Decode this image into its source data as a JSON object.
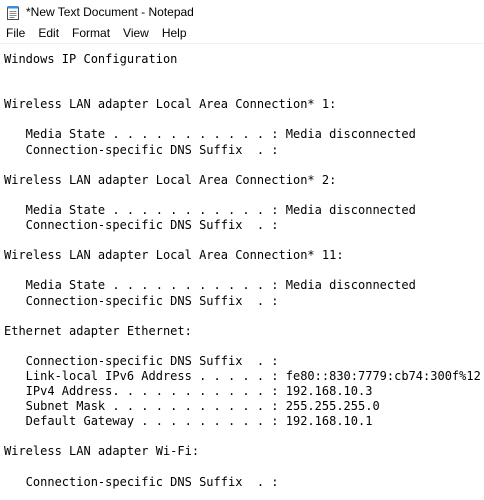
{
  "window": {
    "title": "*New Text Document - Notepad",
    "app_icon": "notepad-icon"
  },
  "menu": {
    "items": [
      "File",
      "Edit",
      "Format",
      "View",
      "Help"
    ]
  },
  "document": {
    "lines": [
      "Windows IP Configuration",
      "",
      "",
      "Wireless LAN adapter Local Area Connection* 1:",
      "",
      "   Media State . . . . . . . . . . . : Media disconnected",
      "   Connection-specific DNS Suffix  . :",
      "",
      "Wireless LAN adapter Local Area Connection* 2:",
      "",
      "   Media State . . . . . . . . . . . : Media disconnected",
      "   Connection-specific DNS Suffix  . :",
      "",
      "Wireless LAN adapter Local Area Connection* 11:",
      "",
      "   Media State . . . . . . . . . . . : Media disconnected",
      "   Connection-specific DNS Suffix  . :",
      "",
      "Ethernet adapter Ethernet:",
      "",
      "   Connection-specific DNS Suffix  . :",
      "   Link-local IPv6 Address . . . . . : fe80::830:7779:cb74:300f%12",
      "   IPv4 Address. . . . . . . . . . . : 192.168.10.3",
      "   Subnet Mask . . . . . . . . . . . : 255.255.255.0",
      "   Default Gateway . . . . . . . . . : 192.168.10.1",
      "",
      "Wireless LAN adapter Wi-Fi:",
      "",
      "   Connection-specific DNS Suffix  . :"
    ]
  }
}
